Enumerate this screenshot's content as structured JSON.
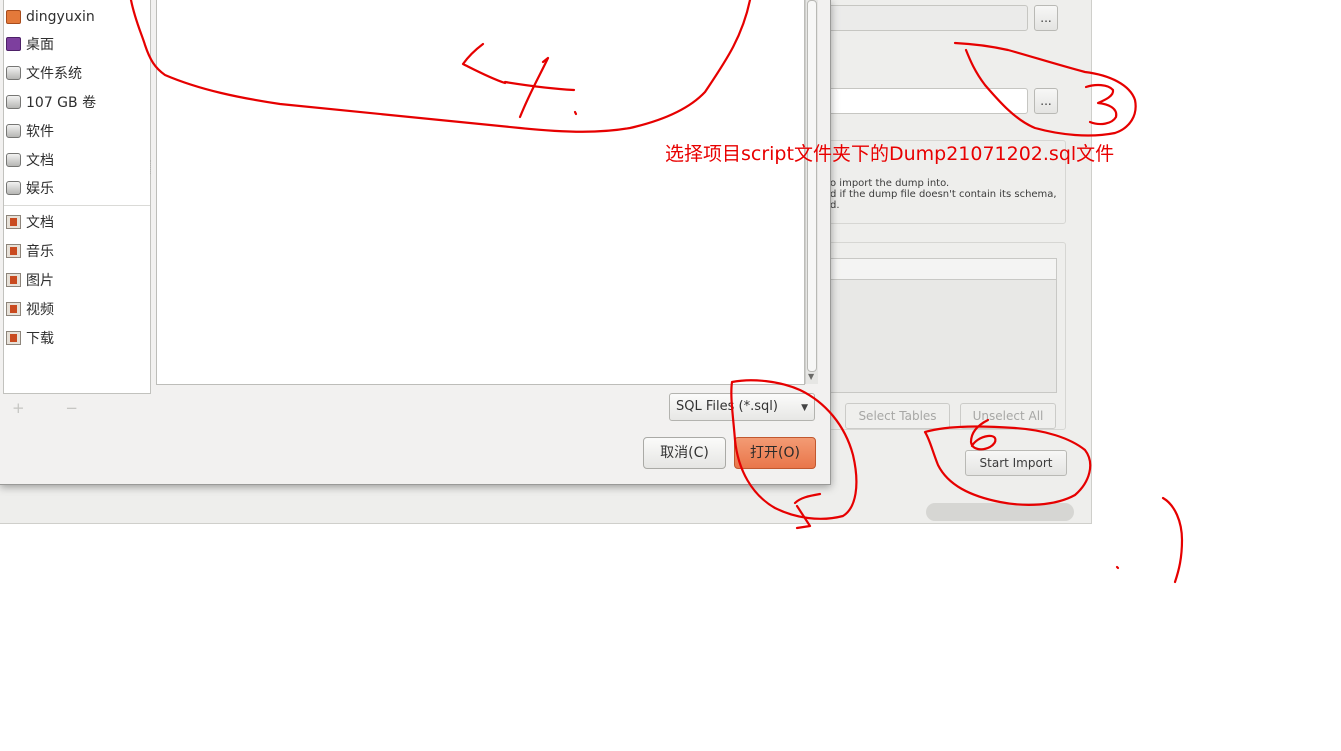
{
  "file_dialog": {
    "places": [
      {
        "label": "dingyuxin",
        "icon": "home-folder-icon"
      },
      {
        "label": "桌面",
        "icon": "desktop-icon"
      },
      {
        "label": "文件系统",
        "icon": "drive-icon"
      },
      {
        "label": "107 GB 卷",
        "icon": "drive-icon"
      },
      {
        "label": "软件",
        "icon": "drive-icon"
      },
      {
        "label": "文档",
        "icon": "drive-icon"
      },
      {
        "label": "娱乐",
        "icon": "drive-icon"
      }
    ],
    "bookmarks": [
      {
        "label": "文档",
        "icon": "documents-folder-icon"
      },
      {
        "label": "音乐",
        "icon": "music-folder-icon"
      },
      {
        "label": "图片",
        "icon": "pictures-folder-icon"
      },
      {
        "label": "视频",
        "icon": "videos-folder-icon"
      },
      {
        "label": "下载",
        "icon": "downloads-folder-icon"
      }
    ],
    "add_remove": "+ −",
    "filter": "SQL Files (*.sql)",
    "cancel_label": "取消(C)",
    "open_label": "打开(O)"
  },
  "background_window": {
    "browse_label_1": "...",
    "browse_label_2": "...",
    "note_line_1": "o import the dump into.",
    "note_line_2": "d if the dump file doesn't contain its schema,",
    "note_line_3": "d.",
    "select_tables_label": "Select Tables",
    "unselect_all_label": "Unselect All",
    "start_import_label": "Start Import"
  },
  "annotation": {
    "caption": "选择项目script文件夹下的Dump21071202.sql文件",
    "color": "#e60000"
  }
}
